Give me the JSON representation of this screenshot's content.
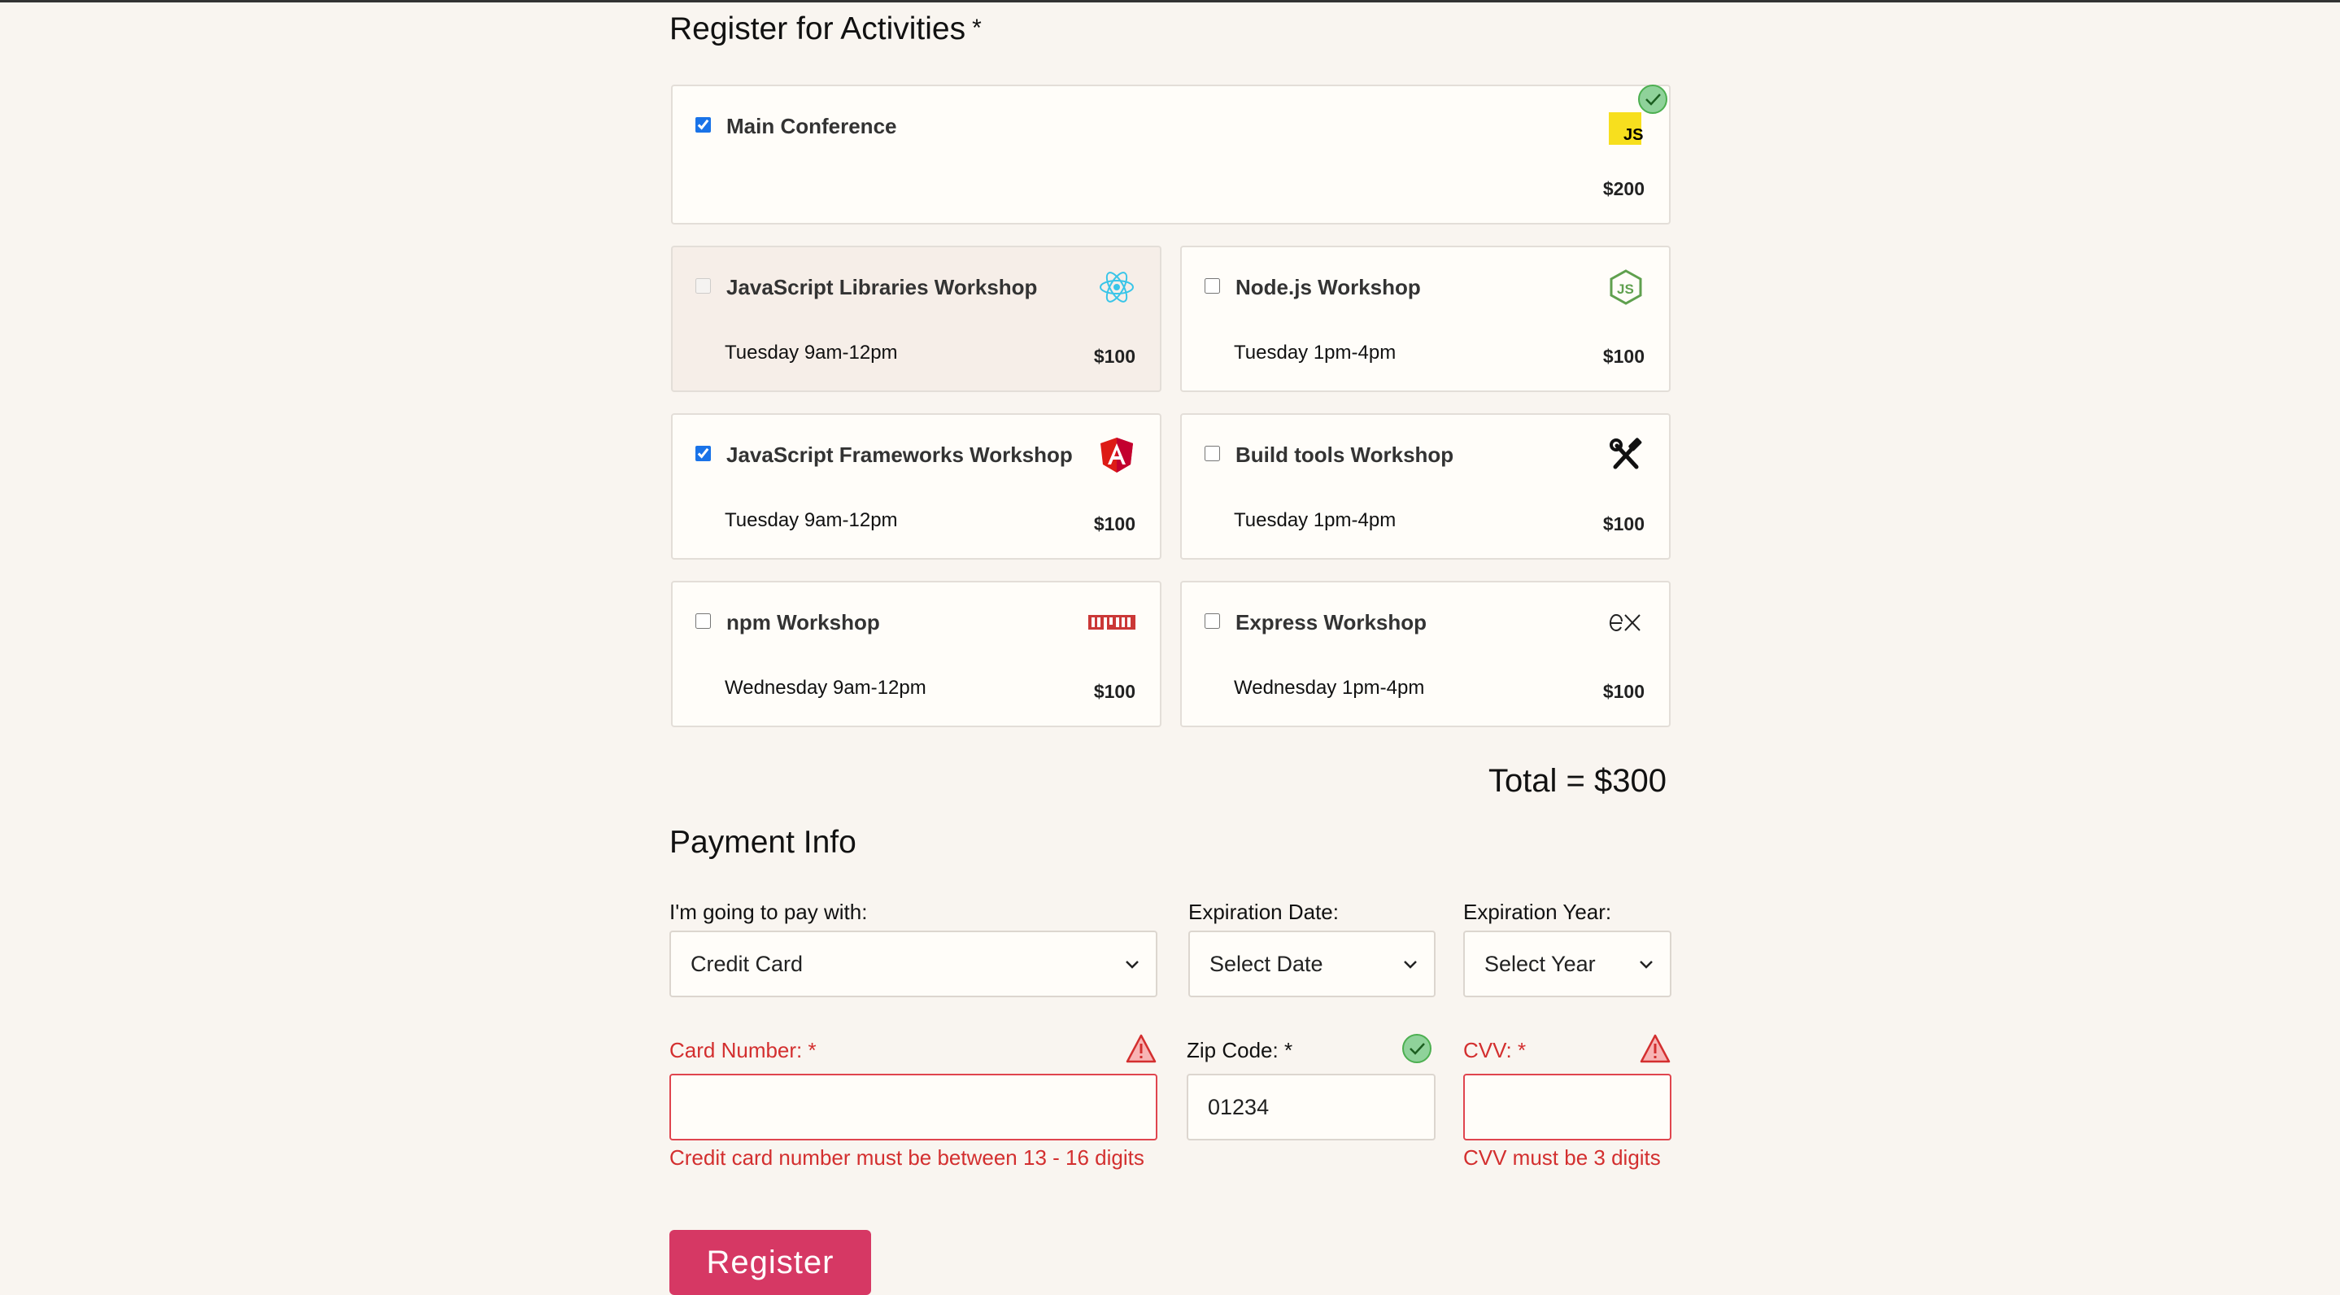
{
  "activities": {
    "heading": "Register for Activities",
    "required_mark": "*",
    "main": {
      "name": "Main Conference",
      "cost": "$200",
      "checked": true,
      "icon": "javascript-icon"
    },
    "workshops": [
      {
        "name": "JavaScript Libraries Workshop",
        "when": "Tuesday 9am-12pm",
        "cost": "$100",
        "checked": false,
        "disabled": true,
        "icon": "react-icon"
      },
      {
        "name": "Node.js Workshop",
        "when": "Tuesday 1pm-4pm",
        "cost": "$100",
        "checked": false,
        "disabled": false,
        "icon": "nodejs-icon"
      },
      {
        "name": "JavaScript Frameworks Workshop",
        "when": "Tuesday 9am-12pm",
        "cost": "$100",
        "checked": true,
        "disabled": false,
        "icon": "angular-icon"
      },
      {
        "name": "Build tools Workshop",
        "when": "Tuesday 1pm-4pm",
        "cost": "$100",
        "checked": false,
        "disabled": false,
        "icon": "tools-icon"
      },
      {
        "name": "npm Workshop",
        "when": "Wednesday 9am-12pm",
        "cost": "$100",
        "checked": false,
        "disabled": false,
        "icon": "npm-icon"
      },
      {
        "name": "Express Workshop",
        "when": "Wednesday 1pm-4pm",
        "cost": "$100",
        "checked": false,
        "disabled": false,
        "icon": "express-icon"
      }
    ],
    "total": "Total = $300"
  },
  "payment": {
    "heading": "Payment Info",
    "pay_with_label": "I'm going to pay with:",
    "pay_with_value": "Credit Card",
    "exp_date_label": "Expiration Date:",
    "exp_date_value": "Select Date",
    "exp_year_label": "Expiration Year:",
    "exp_year_value": "Select Year",
    "card_number_label": "Card Number:",
    "card_number_value": "",
    "card_number_error": "Credit card number must be between 13 - 16 digits",
    "zip_label": "Zip Code:",
    "zip_value": "01234",
    "cvv_label": "CVV:",
    "cvv_value": "",
    "cvv_error": "CVV must be 3 digits",
    "required_mark": "*"
  },
  "register_button": "Register",
  "colors": {
    "error": "#d32f2f",
    "valid": "#4caf50",
    "button": "#d63864",
    "background": "#f9f5f0"
  }
}
